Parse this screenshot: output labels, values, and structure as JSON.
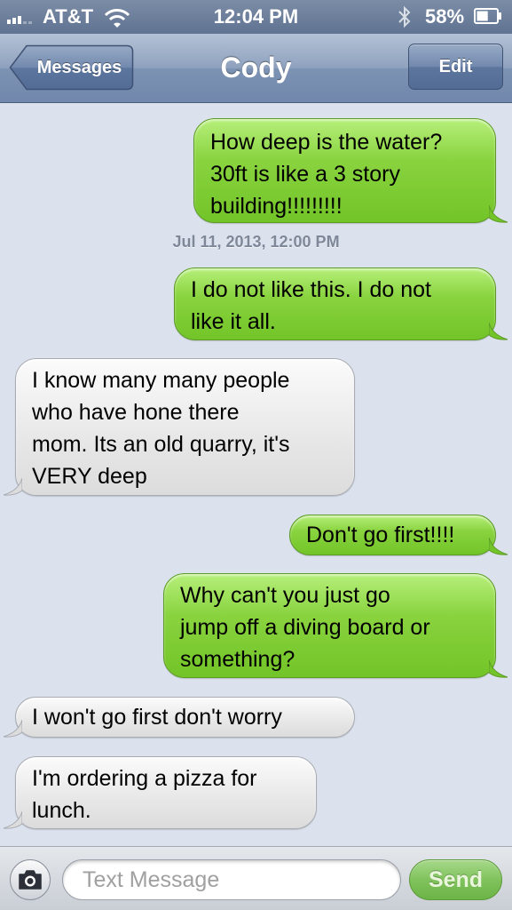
{
  "status_bar": {
    "carrier": "AT&T",
    "time": "12:04 PM",
    "battery_percent": "58%",
    "battery_level": 0.58,
    "signal_bars": 3,
    "icons": [
      "signal-icon",
      "wifi-icon",
      "bluetooth-icon",
      "battery-icon"
    ]
  },
  "nav_bar": {
    "back_label": "Messages",
    "title": "Cody",
    "edit_label": "Edit"
  },
  "conversation": {
    "messages": [
      {
        "direction": "sent",
        "lines": [
          "How deep is the water?",
          "30ft is like a 3 story",
          "building!!!!!!!!!"
        ]
      },
      {
        "direction": "sent",
        "lines": [
          "I do not like this. I do not",
          "like it all."
        ]
      },
      {
        "direction": "received",
        "lines": [
          "I know many many people",
          "who have hone there",
          "mom. Its an old quarry, it's",
          "VERY deep"
        ]
      },
      {
        "direction": "sent",
        "lines": [
          "Don't go first!!!!"
        ]
      },
      {
        "direction": "sent",
        "lines": [
          "Why can't you just go",
          "jump off a diving board or",
          "something?"
        ]
      },
      {
        "direction": "received",
        "lines": [
          "I won't go first don't worry"
        ]
      },
      {
        "direction": "received",
        "lines": [
          "I'm ordering a pizza for",
          "lunch."
        ]
      }
    ],
    "timestamp": "Jul 11, 2013, 12:00 PM"
  },
  "input_bar": {
    "placeholder": "Text Message",
    "send_label": "Send",
    "camera_icon": "camera-icon"
  },
  "colors": {
    "sent_bubble": "#89d33f",
    "received_bubble": "#e7e7e7",
    "background": "#dbe2ed",
    "nav_bar": "#7d93b4",
    "send_button": "#80c25c"
  }
}
